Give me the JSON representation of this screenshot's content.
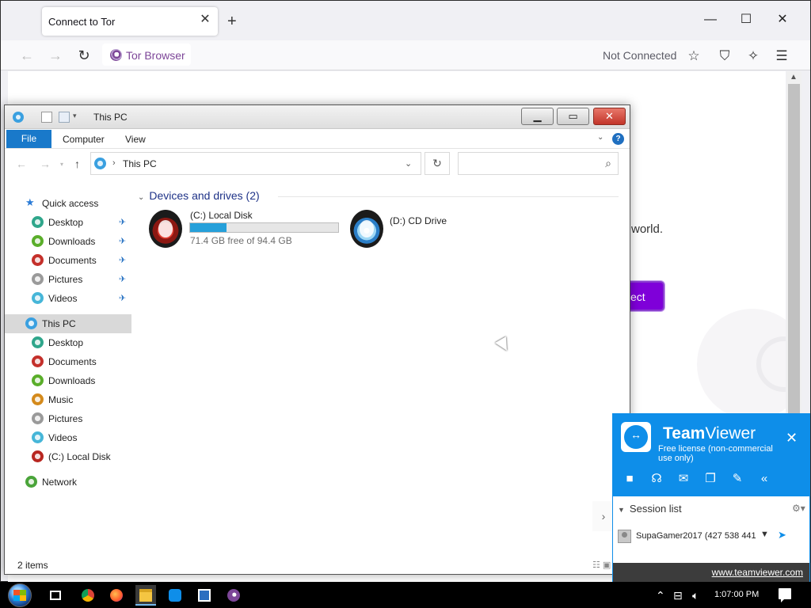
{
  "browser": {
    "tab_title": "Connect to Tor",
    "url_label": "Tor Browser",
    "connection_status": "Not Connected",
    "content_peek_text": "world.",
    "connect_button_partial": "ect",
    "accent_color": "#7f00d9"
  },
  "explorer": {
    "title": "This PC",
    "ribbon_tabs": [
      "File",
      "Computer",
      "View"
    ],
    "breadcrumb": "This PC",
    "search_placeholder": "",
    "nav": {
      "quick_access": "Quick access",
      "quick_items": [
        "Desktop",
        "Downloads",
        "Documents",
        "Pictures",
        "Videos"
      ],
      "this_pc": "This PC",
      "pc_items": [
        "Desktop",
        "Documents",
        "Downloads",
        "Music",
        "Pictures",
        "Videos",
        "(C:) Local Disk"
      ],
      "network": "Network"
    },
    "group_header": "Devices and drives (2)",
    "drives": [
      {
        "name": "(C:) Local Disk",
        "free_text": "71.4 GB free of 94.4 GB",
        "used_fraction": 0.244
      },
      {
        "name": "(D:) CD Drive"
      }
    ],
    "status_items": "2 items"
  },
  "teamviewer": {
    "brand_bold": "Team",
    "brand_rest": "Viewer",
    "license": "Free license (non-commercial use only)",
    "session_list_label": "Session list",
    "session_entry": "SupaGamer2017 (427 538 441",
    "footer_link": "www.teamviewer.com",
    "brand_color": "#0e8ee9"
  },
  "taskbar": {
    "clock": "1:07:00 PM",
    "apps": [
      "start-button",
      "task-view",
      "chrome",
      "firefox",
      "file-explorer",
      "teamviewer",
      "network-app",
      "tor-browser"
    ]
  }
}
